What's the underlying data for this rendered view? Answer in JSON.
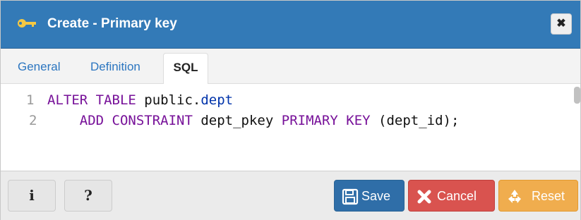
{
  "dialog": {
    "title": "Create - Primary key",
    "title_icon": "key-icon",
    "close_icon": "close-icon"
  },
  "tabs": [
    {
      "label": "General",
      "active": false
    },
    {
      "label": "Definition",
      "active": false
    },
    {
      "label": "SQL",
      "active": true
    }
  ],
  "editor": {
    "lines": [
      {
        "number": "1",
        "keyword": "ALTER TABLE",
        "rest_a": " public.",
        "ident": "dept",
        "rest_b": ""
      },
      {
        "number": "2",
        "indent": "    ",
        "keyword_a": "ADD CONSTRAINT",
        "mid": " dept_pkey ",
        "keyword_b": "PRIMARY KEY",
        "tail": " (dept_id);"
      }
    ]
  },
  "footer": {
    "info_label": "i",
    "help_label": "?",
    "save_label": "Save",
    "cancel_label": "Cancel",
    "reset_label": "Reset"
  },
  "colors": {
    "titlebar": "#337ab7",
    "save": "#2f6ea8",
    "cancel": "#d9534f",
    "reset": "#f0ad4e",
    "keyword": "#771199",
    "identifier": "#0033aa"
  }
}
